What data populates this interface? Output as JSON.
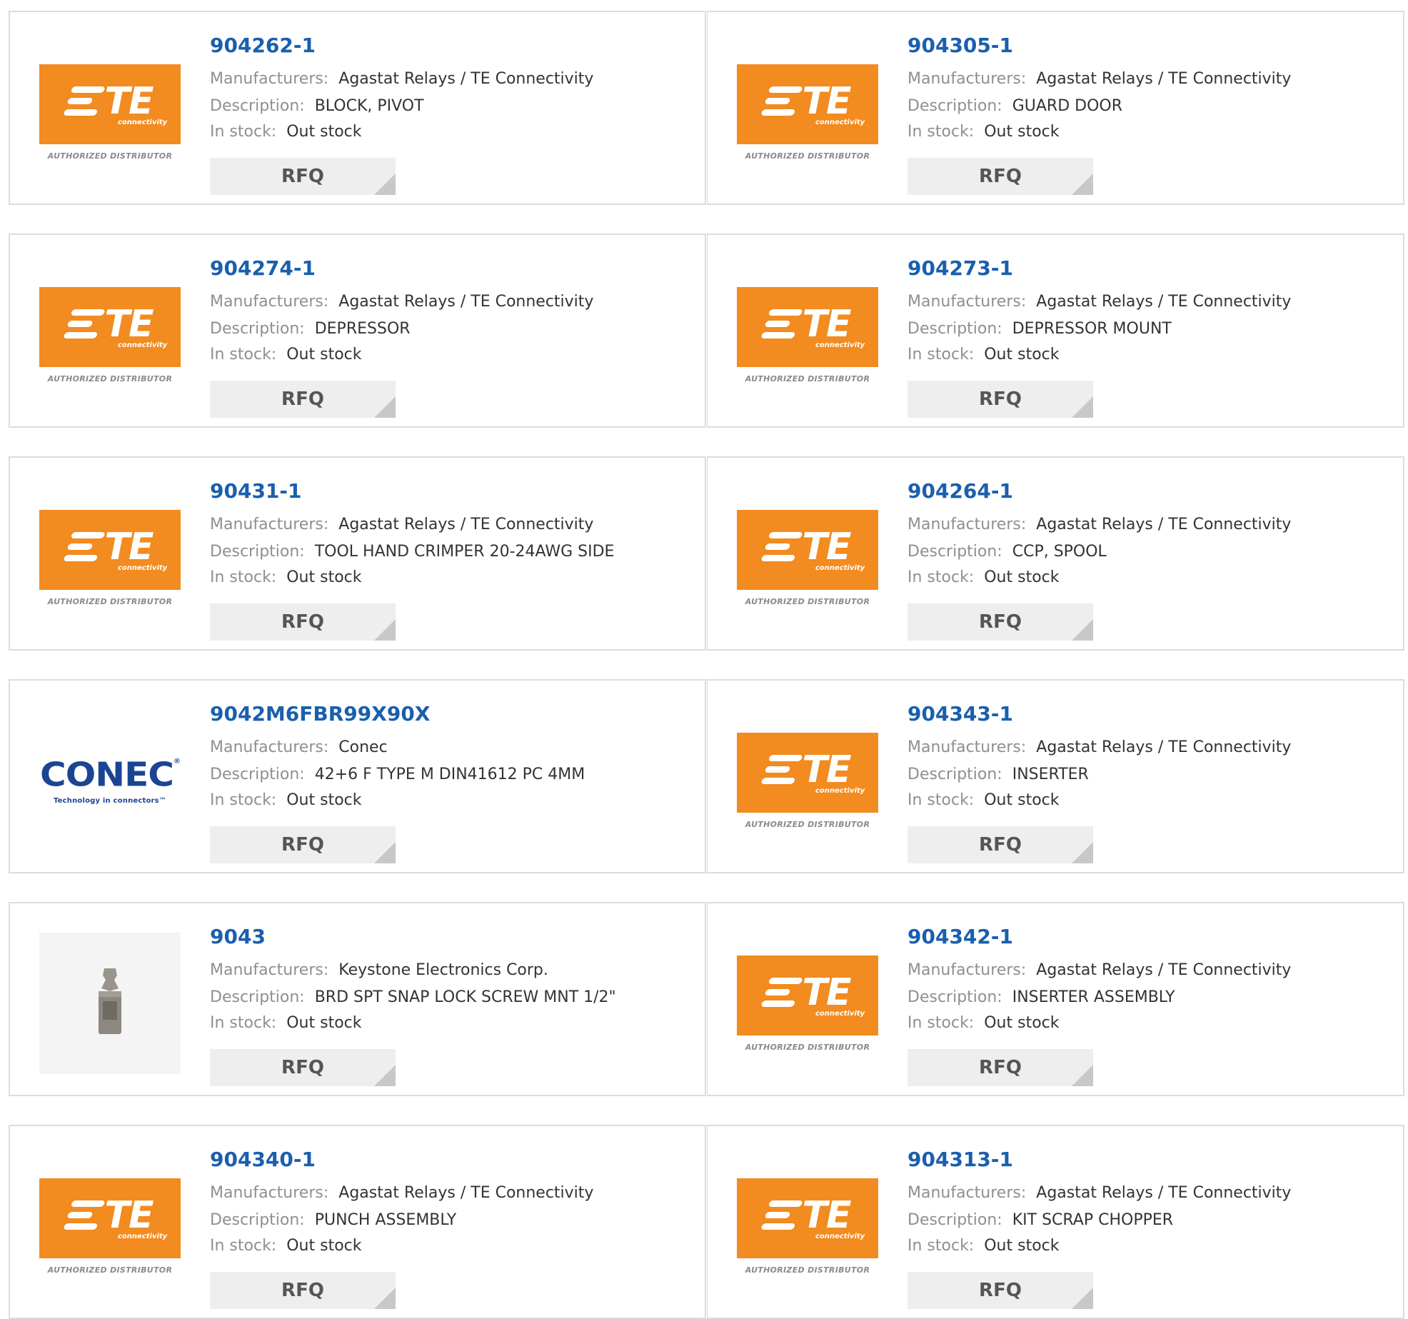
{
  "labels": {
    "manufacturers": "Manufacturers:",
    "description": "Description:",
    "in_stock": "In stock:",
    "rfq": "RFQ"
  },
  "logos": {
    "te": {
      "letters": "TE",
      "sub": "connectivity",
      "authorized": "AUTHORIZED DISTRIBUTOR",
      "color": "#f28b20"
    },
    "conec": {
      "name": "CONEC",
      "reg": "®",
      "tagline": "Technology in connectors™",
      "color": "#1b4592"
    }
  },
  "colors": {
    "part_link": "#1a5fae",
    "label": "#8f8f8f",
    "value": "#333333",
    "rfq_bg": "#eeeeee"
  },
  "products": [
    {
      "part": "904262-1",
      "manufacturer": "Agastat Relays / TE Connectivity",
      "description": "BLOCK, PIVOT",
      "stock": "Out stock",
      "logo": "te"
    },
    {
      "part": "904305-1",
      "manufacturer": "Agastat Relays / TE Connectivity",
      "description": "GUARD DOOR",
      "stock": "Out stock",
      "logo": "te"
    },
    {
      "part": "904274-1",
      "manufacturer": "Agastat Relays / TE Connectivity",
      "description": "DEPRESSOR",
      "stock": "Out stock",
      "logo": "te"
    },
    {
      "part": "904273-1",
      "manufacturer": "Agastat Relays / TE Connectivity",
      "description": "DEPRESSOR MOUNT",
      "stock": "Out stock",
      "logo": "te"
    },
    {
      "part": "90431-1",
      "manufacturer": "Agastat Relays / TE Connectivity",
      "description": "TOOL HAND CRIMPER 20-24AWG SIDE",
      "stock": "Out stock",
      "logo": "te"
    },
    {
      "part": "904264-1",
      "manufacturer": "Agastat Relays / TE Connectivity",
      "description": "CCP, SPOOL",
      "stock": "Out stock",
      "logo": "te"
    },
    {
      "part": "9042M6FBR99X90X",
      "manufacturer": "Conec",
      "description": "42+6 F TYPE M DIN41612 PC 4MM",
      "stock": "Out stock",
      "logo": "conec"
    },
    {
      "part": "904343-1",
      "manufacturer": "Agastat Relays / TE Connectivity",
      "description": "INSERTER",
      "stock": "Out stock",
      "logo": "te"
    },
    {
      "part": "9043",
      "manufacturer": "Keystone Electronics Corp.",
      "description": "BRD SPT SNAP LOCK SCREW MNT 1/2\"",
      "stock": "Out stock",
      "logo": "photo"
    },
    {
      "part": "904342-1",
      "manufacturer": "Agastat Relays / TE Connectivity",
      "description": "INSERTER ASSEMBLY",
      "stock": "Out stock",
      "logo": "te"
    },
    {
      "part": "904340-1",
      "manufacturer": "Agastat Relays / TE Connectivity",
      "description": "PUNCH ASSEMBLY",
      "stock": "Out stock",
      "logo": "te"
    },
    {
      "part": "904313-1",
      "manufacturer": "Agastat Relays / TE Connectivity",
      "description": "KIT SCRAP CHOPPER",
      "stock": "Out stock",
      "logo": "te"
    }
  ]
}
